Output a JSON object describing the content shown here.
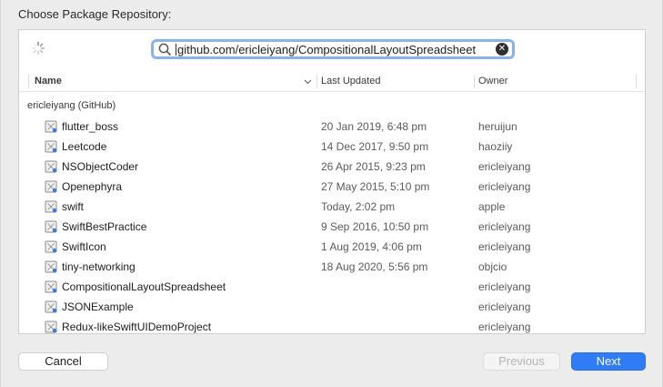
{
  "dialog": {
    "title": "Choose Package Repository:"
  },
  "search": {
    "value": "github.com/ericleiyang/CompositionalLayoutSpreadsheet"
  },
  "table": {
    "columns": {
      "name": "Name",
      "updated": "Last Updated",
      "owner": "Owner"
    },
    "group": "ericleiyang (GitHub)",
    "rows": [
      {
        "name": "flutter_boss",
        "updated": "20 Jan 2019, 6:48 pm",
        "owner": "heruijun"
      },
      {
        "name": "Leetcode",
        "updated": "14 Dec 2017, 9:50 pm",
        "owner": "haoziiy"
      },
      {
        "name": "NSObjectCoder",
        "updated": "26 Apr 2015, 9:23 pm",
        "owner": "ericleiyang"
      },
      {
        "name": "Openephyra",
        "updated": "27 May 2015, 5:10 pm",
        "owner": "ericleiyang"
      },
      {
        "name": "swift",
        "updated": "Today, 2:02 pm",
        "owner": "apple"
      },
      {
        "name": "SwiftBestPractice",
        "updated": "9 Sep 2016, 10:50 pm",
        "owner": "ericleiyang"
      },
      {
        "name": "SwiftIcon",
        "updated": "1 Aug 2019, 4:06 pm",
        "owner": "ericleiyang"
      },
      {
        "name": "tiny-networking",
        "updated": "18 Aug 2020, 5:56 pm",
        "owner": "objcio"
      },
      {
        "name": "CompositionalLayoutSpreadsheet",
        "updated": "",
        "owner": "ericleiyang"
      },
      {
        "name": "JSONExample",
        "updated": "",
        "owner": "ericleiyang"
      },
      {
        "name": "Redux-likeSwiftUIDemoProject",
        "updated": "",
        "owner": "ericleiyang"
      }
    ]
  },
  "buttons": {
    "cancel": "Cancel",
    "previous": "Previous",
    "next": "Next"
  },
  "colors": {
    "accent": "#2f7cf6",
    "focus_ring": "#8ab1e8"
  },
  "icons": {
    "row": "package-icon",
    "search": "search-icon",
    "clear": "clear-icon",
    "sort": "chevron-down-icon",
    "loading": "spinner-icon"
  }
}
